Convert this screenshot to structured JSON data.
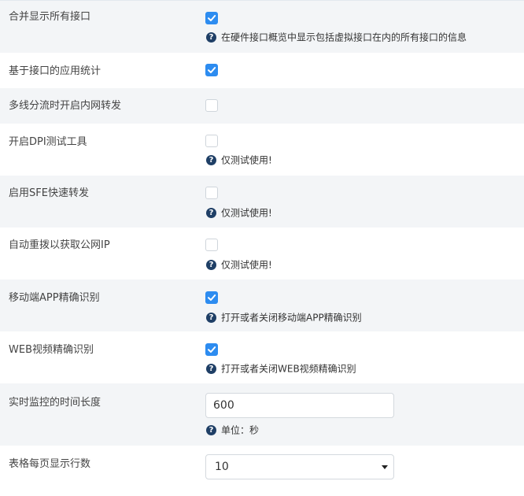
{
  "settings": [
    {
      "label": "合并显示所有接口",
      "checked": true,
      "hint": "在硬件接口概览中显示包括虚拟接口在内的所有接口的信息"
    },
    {
      "label": "基于接口的应用统计",
      "checked": true,
      "hint": ""
    },
    {
      "label": "多线分流时开启内网转发",
      "checked": false,
      "hint": ""
    },
    {
      "label": "开启DPI测试工具",
      "checked": false,
      "hint": "仅测试使用!"
    },
    {
      "label": "启用SFE快速转发",
      "checked": false,
      "hint": "仅测试使用!"
    },
    {
      "label": "自动重拨以获取公网IP",
      "checked": false,
      "hint": "仅测试使用!"
    },
    {
      "label": "移动端APP精确识别",
      "checked": true,
      "hint": "打开或者关闭移动端APP精确识别"
    },
    {
      "label": "WEB视频精确识别",
      "checked": true,
      "hint": "打开或者关闭WEB视频精确识别"
    }
  ],
  "monitor_duration": {
    "label": "实时监控的时间长度",
    "value": "600",
    "hint": "单位：秒"
  },
  "rows_per_page": {
    "label": "表格每页显示行数",
    "selected": "10"
  },
  "colors": {
    "accent": "#2d8cf0",
    "row_alt": "#f3f5f7",
    "hint_icon": "#1f3f66"
  },
  "icons": {
    "checkbox_mark": "check-icon",
    "hint": "question-circle-icon",
    "select": "caret-down-icon"
  }
}
